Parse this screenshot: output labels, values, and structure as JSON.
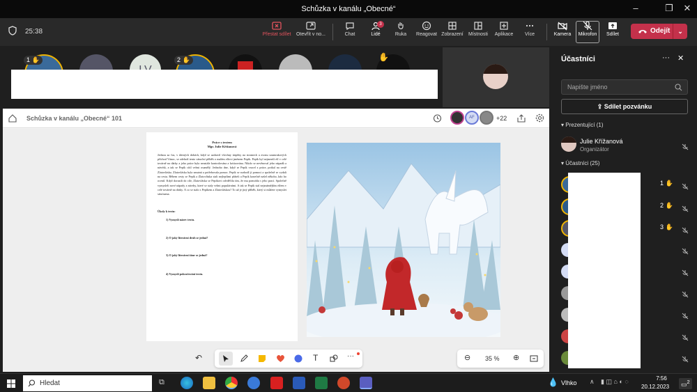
{
  "window": {
    "title": "Schůzka v kanálu „Obecné“"
  },
  "toolbar": {
    "timer": "25:38",
    "stop_share": "Přestat sdílet",
    "open_in": "Otevřít v no...",
    "chat": "Chat",
    "people": "Lidé",
    "people_badge": "3",
    "raise": "Ruka",
    "react": "Reagovat",
    "view": "Zobrazení",
    "rooms": "Místnosti",
    "apps": "Aplikace",
    "more": "Více",
    "camera": "Kamera",
    "mic": "Mikrofon",
    "share": "Sdílet",
    "leave": "Odejít"
  },
  "strip": {
    "hand1": "1",
    "hand2": "2",
    "initials": "LV"
  },
  "share": {
    "title": "Schůzka v kanálu „Obecné“ 101",
    "avatar_initials": "AF",
    "count": "+22",
    "zoom": "35 %"
  },
  "doc": {
    "title": "Práce s textem",
    "author": "Mgr. Julie Křížanová",
    "body": "Jednou za čas, v dávných dobách, když se uzdravil všechny útrpěny na stromech a zvonu soumrakových příchod Vánoc, se odehrál tento vánoční příběh o malém elfovi jménem Pepík. Pepík byl nejmenší elf v celé továrně na dárky a jeho práce byla neustále kontrolována a kritizována. Nikdo se nevěnoval jeho nápadů a návrhů, a tak se Pepík cítil velmi osamělý. Jednoho dne, když se Pepík vracel z práce, potkal na cestě Zlatovlásku. Zlatovláska byla smutná a potřebovala pomoc. Pepík se rozhodl jí pomoci a společně se vydali na cestu. Během cesty se Pepík a Zlatovláska stali nejlepšími přáteli a Pepík konečně našel někoho, kdo ho ocenil. Když dorazili do cíle, Zlatovláska se Pepíkovi odvděčila tím, že mu pomohla s jeho prací. Společně vymysleli nové nápady a návrhy, které se staly velmi populárními. A tak se Pepík stal nejznámějším elfem v celé továrně na dárky. A co se stalo s Pepíkem a Zlatovláskou? To už je jiný příběh, který si můžete vymyslet sám/sama.",
    "tasks_title": "Úkoly k textu:",
    "tasks": [
      "1) Vymysli název textu.",
      "2) O jaký literární druh se jedná?",
      "3) O jaký literární žánr se jedná?",
      "4) Vymysli pokračování textu."
    ]
  },
  "panel": {
    "title": "Účastníci",
    "search_placeholder": "Napište jméno",
    "invite": "Sdílet pozvánku",
    "presenters": "Prezentující (1)",
    "presenter_name": "Julie Křížanová",
    "presenter_role": "Organizátor",
    "attendees": "Účastníci (25)",
    "hands": [
      "1",
      "2",
      "3"
    ]
  },
  "taskbar": {
    "search": "Hledat",
    "weather": "Vlhko",
    "time": "7:56",
    "date": "20.12.2023",
    "notif": "2"
  },
  "colors": {
    "accent": "#c4314b",
    "teams": "#6264a7"
  }
}
